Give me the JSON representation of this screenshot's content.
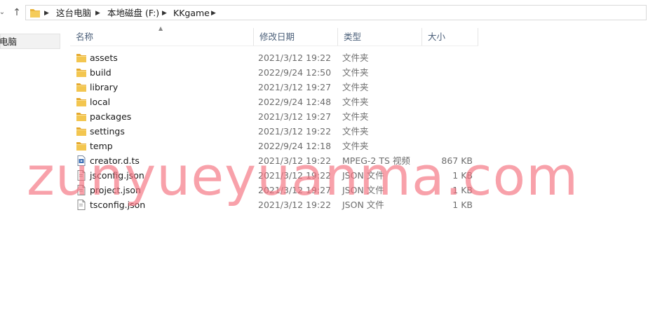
{
  "address": {
    "crumbs": [
      "这台电脑",
      "本地磁盘 (F:)",
      "KKgame"
    ]
  },
  "nav_pane": {
    "selected_item": "电脑"
  },
  "columns": {
    "name": "名称",
    "date": "修改日期",
    "type": "类型",
    "size": "大小"
  },
  "files": [
    {
      "name": "assets",
      "date": "2021/3/12 19:22",
      "type": "文件夹",
      "size": "",
      "icon": "folder-icon"
    },
    {
      "name": "build",
      "date": "2022/9/24 12:50",
      "type": "文件夹",
      "size": "",
      "icon": "folder-icon"
    },
    {
      "name": "library",
      "date": "2021/3/12 19:27",
      "type": "文件夹",
      "size": "",
      "icon": "folder-icon"
    },
    {
      "name": "local",
      "date": "2022/9/24 12:48",
      "type": "文件夹",
      "size": "",
      "icon": "folder-icon"
    },
    {
      "name": "packages",
      "date": "2021/3/12 19:27",
      "type": "文件夹",
      "size": "",
      "icon": "folder-icon"
    },
    {
      "name": "settings",
      "date": "2021/3/12 19:22",
      "type": "文件夹",
      "size": "",
      "icon": "folder-icon"
    },
    {
      "name": "temp",
      "date": "2022/9/24 12:18",
      "type": "文件夹",
      "size": "",
      "icon": "folder-icon"
    },
    {
      "name": "creator.d.ts",
      "date": "2021/3/12 19:22",
      "type": "MPEG-2 TS 视频",
      "size": "867 KB",
      "icon": "video-file-icon"
    },
    {
      "name": "jsconfig.json",
      "date": "2021/3/12 19:22",
      "type": "JSON 文件",
      "size": "1 KB",
      "icon": "json-file-icon"
    },
    {
      "name": "project.json",
      "date": "2021/3/12 19:27",
      "type": "JSON 文件",
      "size": "1 KB",
      "icon": "json-file-icon"
    },
    {
      "name": "tsconfig.json",
      "date": "2021/3/12 19:22",
      "type": "JSON 文件",
      "size": "1 KB",
      "icon": "json-file-icon"
    }
  ],
  "watermark": "zunyueyuanma.com",
  "colors": {
    "folder": "#f0c24b",
    "header_text": "#4c607a",
    "watermark": "#f56e7d"
  }
}
